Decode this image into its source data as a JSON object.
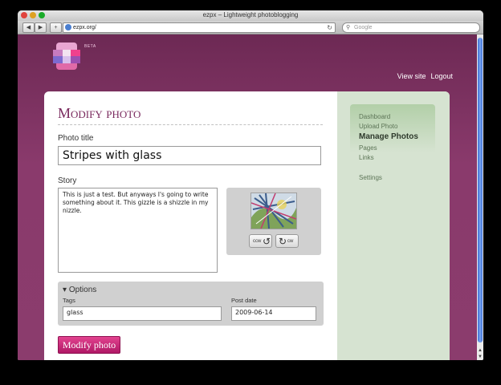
{
  "window": {
    "title": "ezpx – Lightweight photoblogging"
  },
  "toolbar": {
    "back_glyph": "◀",
    "forward_glyph": "▶",
    "add_glyph": "+",
    "url": "ezpx.org/",
    "reload_glyph": "↻",
    "search_placeholder": "Google",
    "search_glyph": "⚲"
  },
  "header": {
    "beta": "BETA",
    "links": {
      "view_site": "View site",
      "logout": "Logout"
    }
  },
  "sidebar": {
    "items": [
      {
        "label": "Dashboard",
        "active": false
      },
      {
        "label": "Upload Photo",
        "active": false
      },
      {
        "label": "Manage Photos",
        "active": true
      },
      {
        "label": "Pages",
        "active": false
      },
      {
        "label": "Links",
        "active": false
      },
      {
        "label": "Settings",
        "active": false
      }
    ]
  },
  "form": {
    "heading": "Modify photo",
    "photo_title_label": "Photo title",
    "photo_title_value": "Stripes with glass",
    "story_label": "Story",
    "story_value": "This is just a test. But anyways I's going to write something about it. This gizzle is a shizzle in my nizzle.",
    "rotate_ccw": "ccw",
    "rotate_cw": "cw",
    "options_label": "Options",
    "options_toggle_glyph": "▾",
    "tags_label": "Tags",
    "tags_value": "glass",
    "post_date_label": "Post date",
    "post_date_value": "2009-06-14",
    "submit_label": "Modify photo"
  },
  "colors": {
    "accent": "#c0267a",
    "background": "#7f3564",
    "sidebar": "#d6e3d1",
    "heading": "#7a2a5e"
  }
}
